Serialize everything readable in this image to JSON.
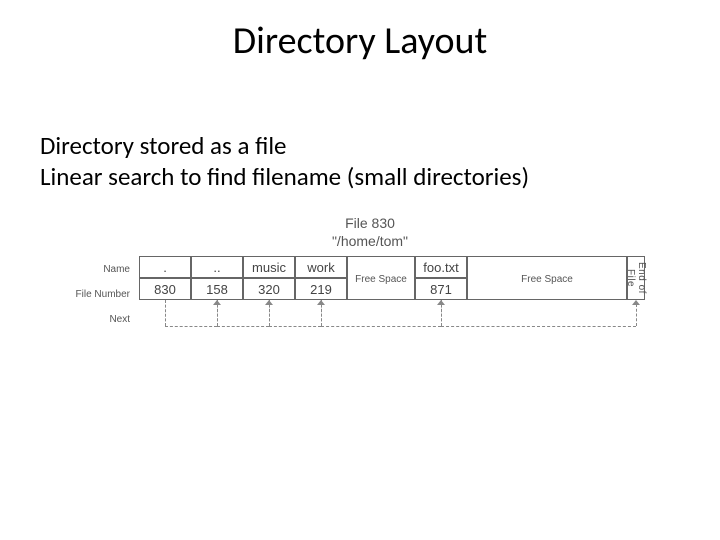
{
  "title": "Directory Layout",
  "body_line1": "Directory stored as a file",
  "body_line2": "Linear search to find filename (small directories)",
  "file_header_line1": "File 830",
  "file_header_line2": "\"/home/tom\"",
  "row_labels": {
    "name": "Name",
    "file_number": "File Number",
    "next": "Next"
  },
  "entries": [
    {
      "name": ".",
      "number": "830"
    },
    {
      "name": "..",
      "number": "158"
    },
    {
      "name": "music",
      "number": "320"
    },
    {
      "name": "work",
      "number": "219"
    },
    {
      "name": "foo.txt",
      "number": "871"
    }
  ],
  "free_space_label": "Free Space",
  "end_of_file_label": "End of File"
}
